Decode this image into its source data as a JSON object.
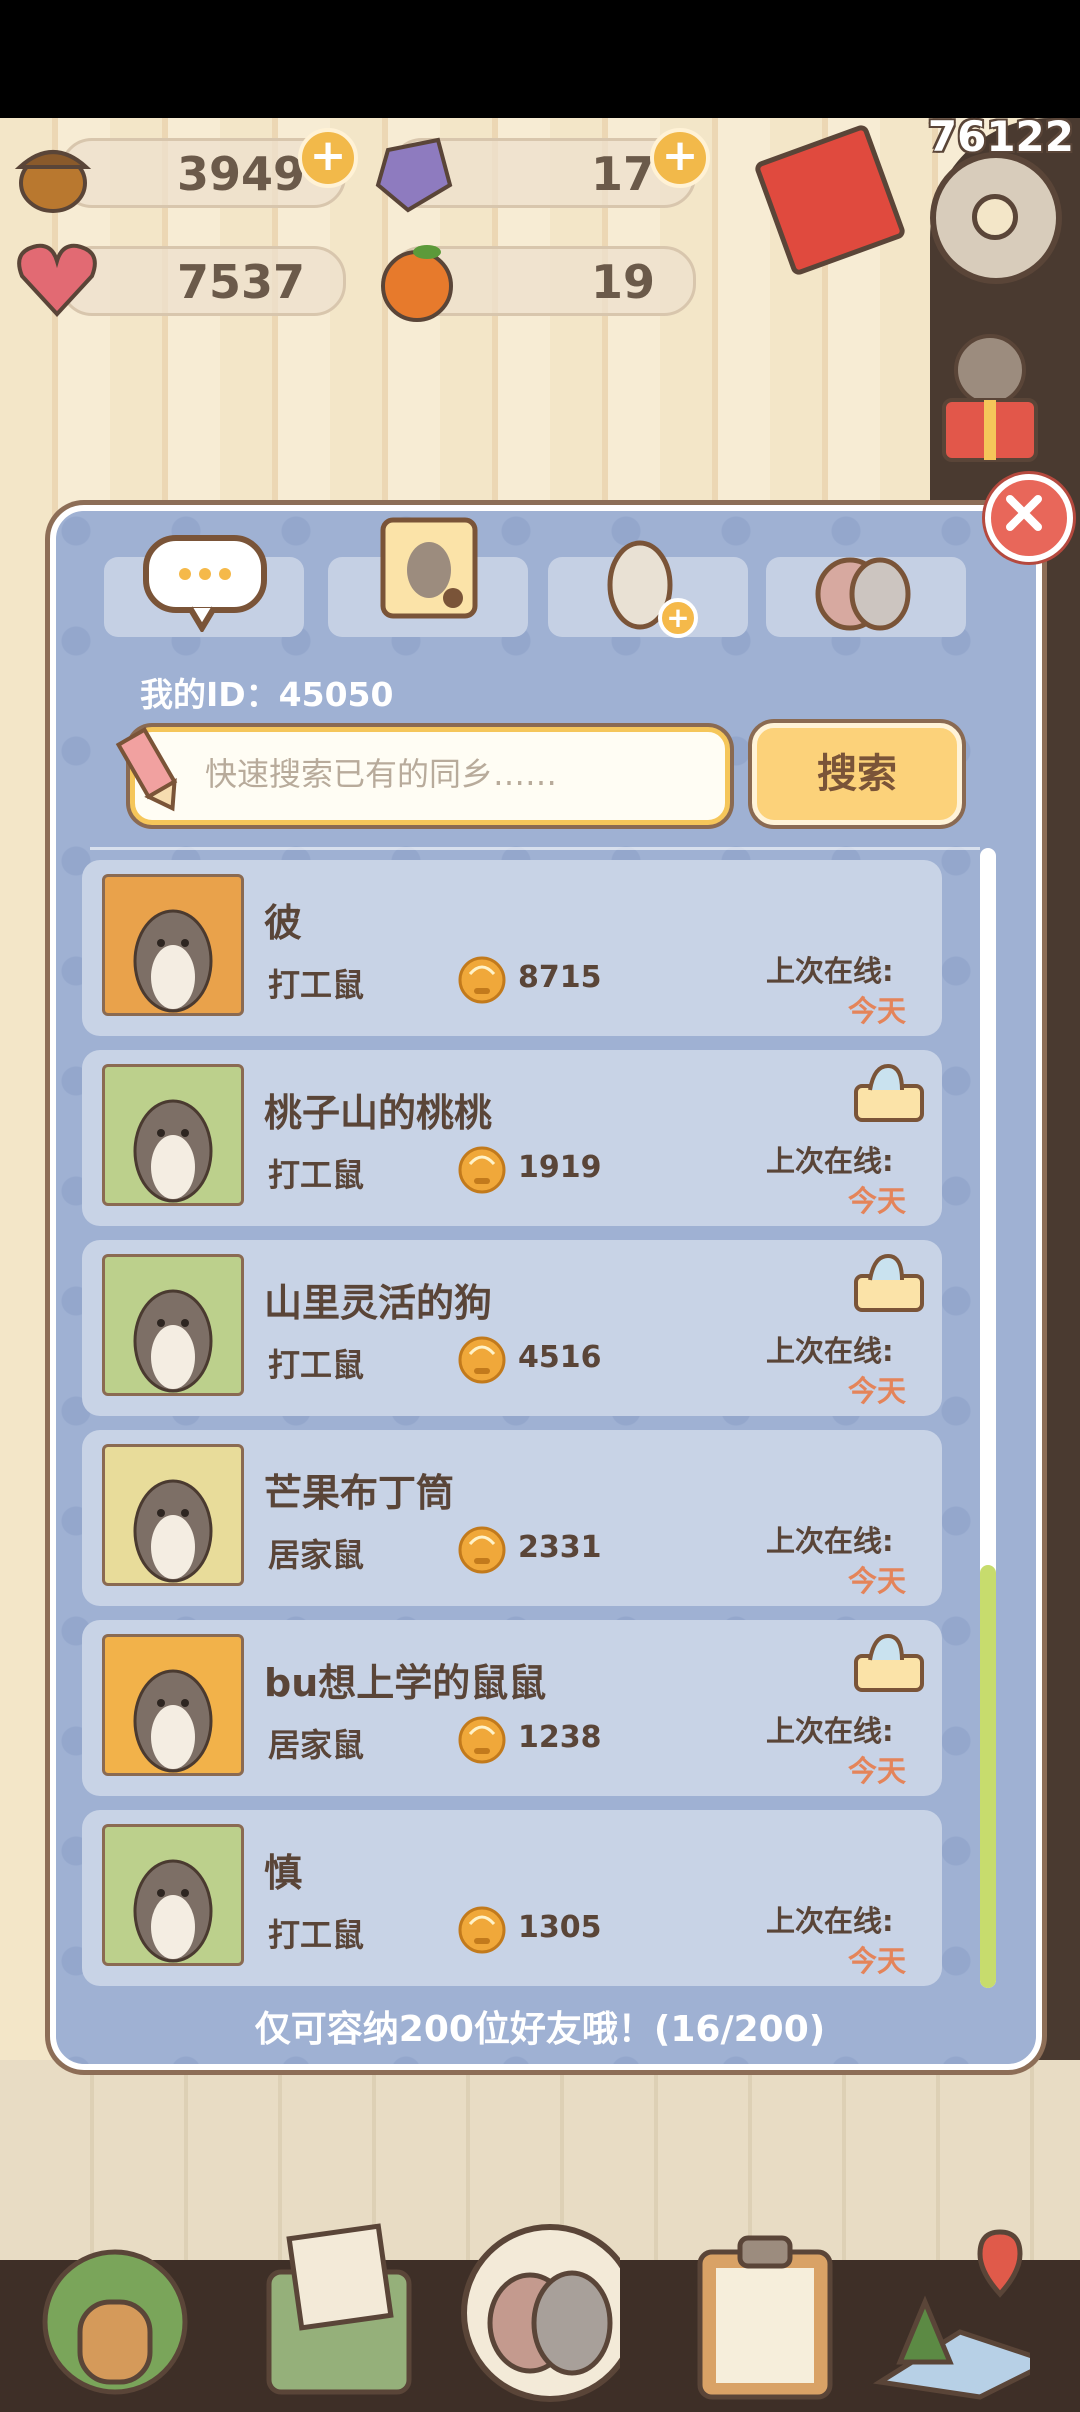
{
  "header": {
    "acorns": "3949",
    "gems": "17",
    "hearts": "7537",
    "oranges": "19",
    "top_counter": "76122"
  },
  "friends": {
    "my_id": "我的ID：45050",
    "search": {
      "placeholder": "快速搜索已有的同乡……",
      "button_label": "搜索"
    },
    "list": [
      {
        "name": "彼",
        "role": "打工鼠",
        "coins": "8715",
        "last_online_label": "上次在线:",
        "last_online": "今天",
        "has_chat": false,
        "avatar_bg": "#e9a24b"
      },
      {
        "name": "桃子山的桃桃",
        "role": "打工鼠",
        "coins": "1919",
        "last_online_label": "上次在线:",
        "last_online": "今天",
        "has_chat": true,
        "avatar_bg": "#bcd08c"
      },
      {
        "name": "山里灵活的狗",
        "role": "打工鼠",
        "coins": "4516",
        "last_online_label": "上次在线:",
        "last_online": "今天",
        "has_chat": true,
        "avatar_bg": "#bcd08c"
      },
      {
        "name": "芒果布丁筒",
        "role": "居家鼠",
        "coins": "2331",
        "last_online_label": "上次在线:",
        "last_online": "今天",
        "has_chat": false,
        "avatar_bg": "#e8dc9a"
      },
      {
        "name": "bu想上学的鼠鼠",
        "role": "居家鼠",
        "coins": "1238",
        "last_online_label": "上次在线:",
        "last_online": "今天",
        "has_chat": true,
        "avatar_bg": "#f2b24a"
      },
      {
        "name": "慎",
        "role": "打工鼠",
        "coins": "1305",
        "last_online_label": "上次在线:",
        "last_online": "今天",
        "has_chat": false,
        "avatar_bg": "#bcd08c"
      }
    ],
    "capacity_text": "仅可容纳200位好友哦！(16/200)"
  },
  "tabs": [
    {
      "icon": "chat-bubble-icon"
    },
    {
      "icon": "friend-notebook-icon"
    },
    {
      "icon": "add-friend-icon"
    },
    {
      "icon": "paw-icon"
    }
  ],
  "bottom_nav": [
    {
      "icon": "house-icon"
    },
    {
      "icon": "letter-icon"
    },
    {
      "icon": "paw-seal-icon"
    },
    {
      "icon": "clipboard-icon"
    },
    {
      "icon": "map-icon"
    }
  ],
  "colors": {
    "dialog_bg": "#9fb1d3",
    "card_bg": "#c8d3e6",
    "accent_orange": "#e4845a",
    "button_yellow": "#fcd27a",
    "text_brown": "#5a4538",
    "scroll_thumb": "#c7dc6d"
  }
}
